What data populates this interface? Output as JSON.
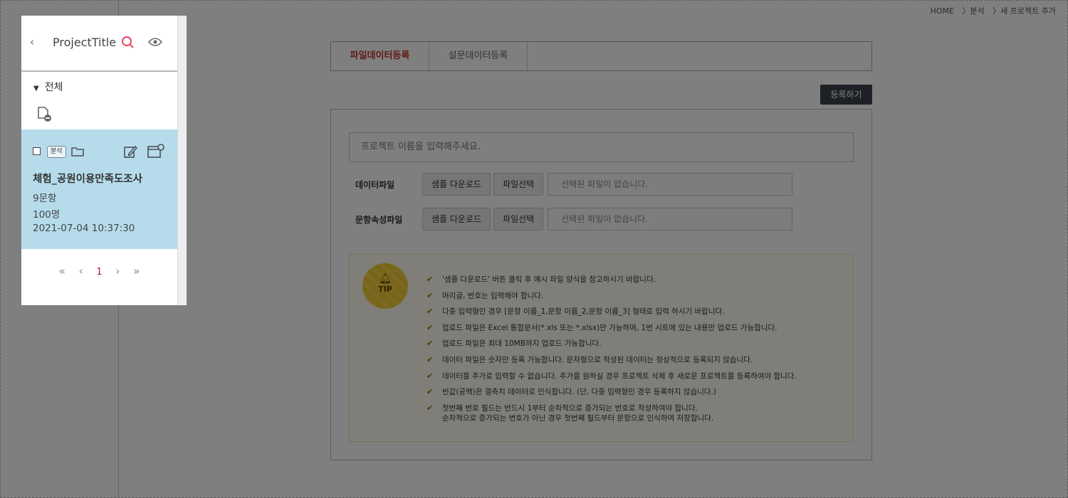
{
  "breadcrumb": {
    "home": "HOME",
    "level1": "〉분석",
    "level2": "〉새 프로젝트 추가"
  },
  "tabs": [
    {
      "label": "파일데이터등록",
      "active": true
    },
    {
      "label": "설문데이터등록",
      "active": false
    }
  ],
  "register_label": "등록하기",
  "form": {
    "name_placeholder": "프로젝트 이름을 입력해주세요.",
    "rows": [
      {
        "label": "데이터파일",
        "sample_label": "샘플 다운로드",
        "select_label": "파일선택",
        "file_text": "선택된 파일이 없습니다."
      },
      {
        "label": "문항속성파일",
        "sample_label": "샘플 다운로드",
        "select_label": "파일선택",
        "file_text": "선택된 파일이 없습니다."
      }
    ]
  },
  "tip": {
    "badge": "TIP",
    "items": [
      "'샘플 다운로드' 버튼 클릭 후 예시 파일 양식을 참고하시기 바랍니다.",
      "머리글, 번호는 입력해야 합니다.",
      "다중 입력형인 경우 [문항 이름_1,문항 이름_2,문항 이름_3] 형태로 입력 하시기 바랍니다.",
      "업로드 파일은 Excel 통합문서(*.xls 또는 *.xlsx)만 가능하며, 1번 시트에 있는 내용만 업로드 가능합니다.",
      "업로드 파일은 최대 10MB까지 업로드 가능합니다.",
      "데이터 파일은 숫자만 등록 가능합니다. 문자형으로 작성된 데이터는 정상적으로 등록되지 않습니다.",
      "데이터를 추가로 입력할 수 없습니다. 추가를 원하실 경우 프로젝트 삭제 후 새로운 프로젝트를 등록하여야 합니다.",
      "빈값(공백)은 결측치 데이터로 인식합니다. (단, 다중 입력형인 경우 등록하지 않습니다.)",
      "첫번째 번호 필드는 반드시 1부터 순차적으로 증가되는 번호로 작성하여야 합니다."
    ],
    "last_item_line2": "순차적으로 증가되는 번호가 아닌 경우 첫번째 필드부터 문항으로 인식하여 저장합니다."
  },
  "panel": {
    "title": "ProjectTitle",
    "tree_label": "전체",
    "item": {
      "tag": "분석",
      "name": "체험_공원이용만족도조사",
      "questions": "9문항",
      "respondents": "100명",
      "date": "2021-07-04 10:37:30"
    },
    "pager": {
      "current": "1"
    }
  },
  "colors": {
    "accent": "#c0392b",
    "selected_bg": "#b6dcec",
    "tip_bg": "#fffdf1",
    "button_dark": "#3b4148"
  }
}
